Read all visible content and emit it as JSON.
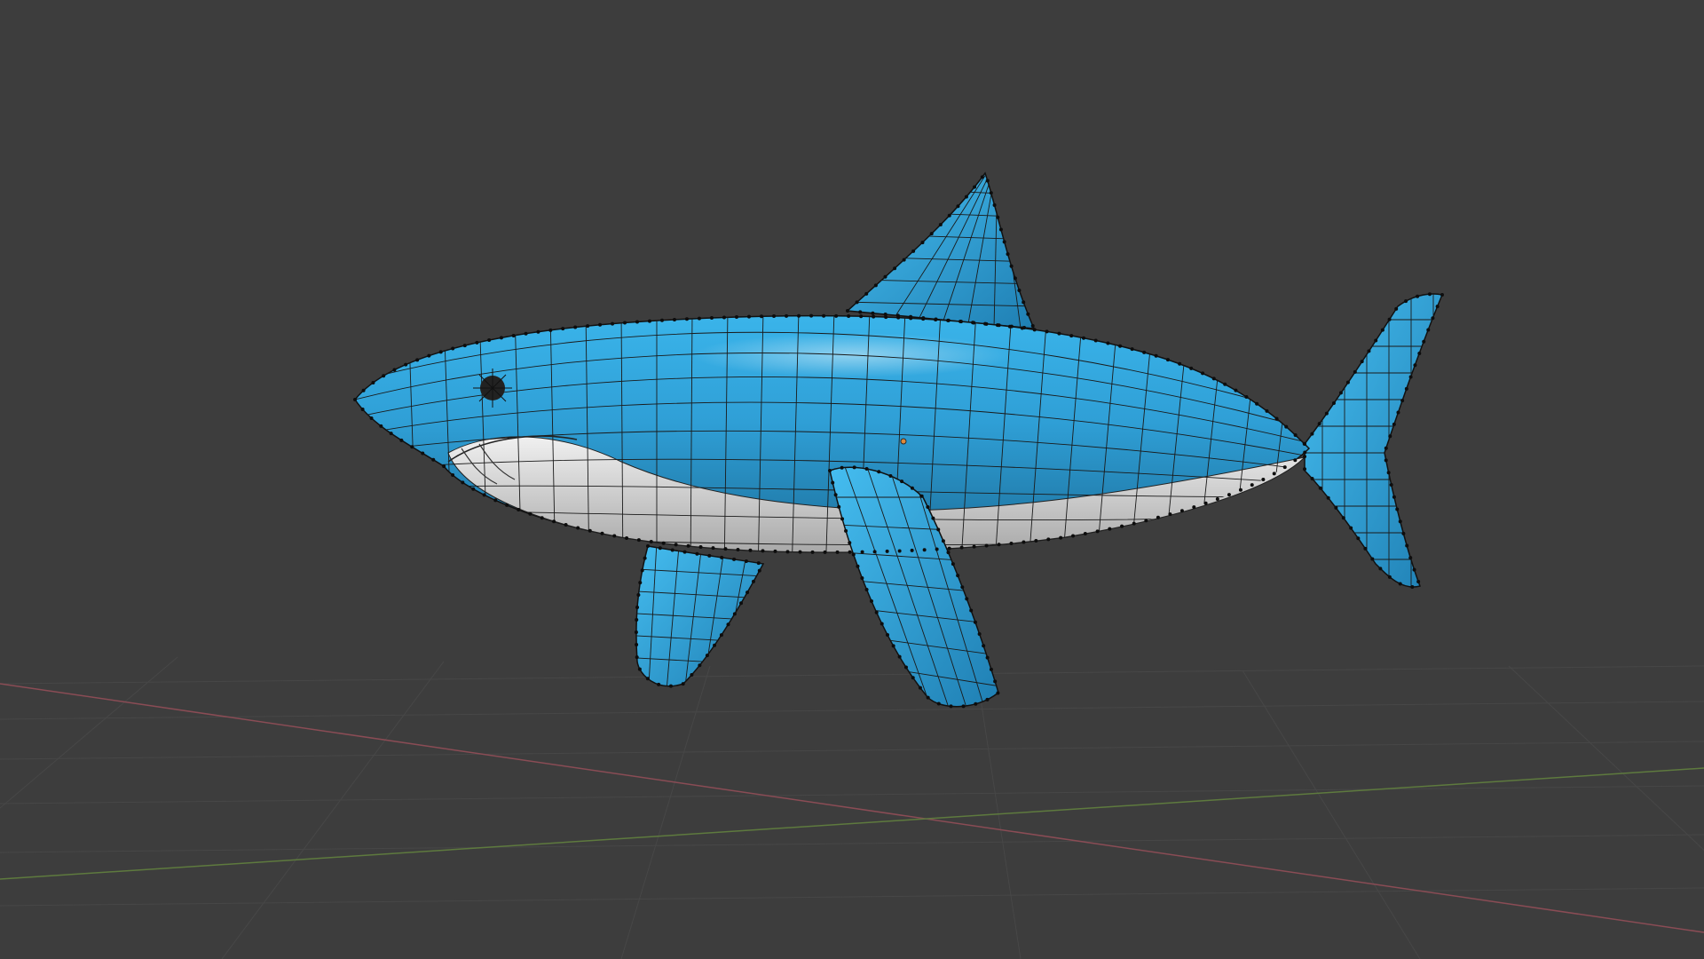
{
  "viewport": {
    "background_color": "#3d3d3d",
    "grid_color": "#474747",
    "x_axis_color": "#8a4c55",
    "y_axis_color": "#5e7a3e"
  },
  "object": {
    "name_icon": "shark-mesh",
    "body_color": "#2f9fd6",
    "belly_color": "#d9d9d9",
    "wire_color": "#1a1a1a",
    "vertex_color": "#0d0d0d"
  },
  "origin_icon": "object-origin-dot"
}
